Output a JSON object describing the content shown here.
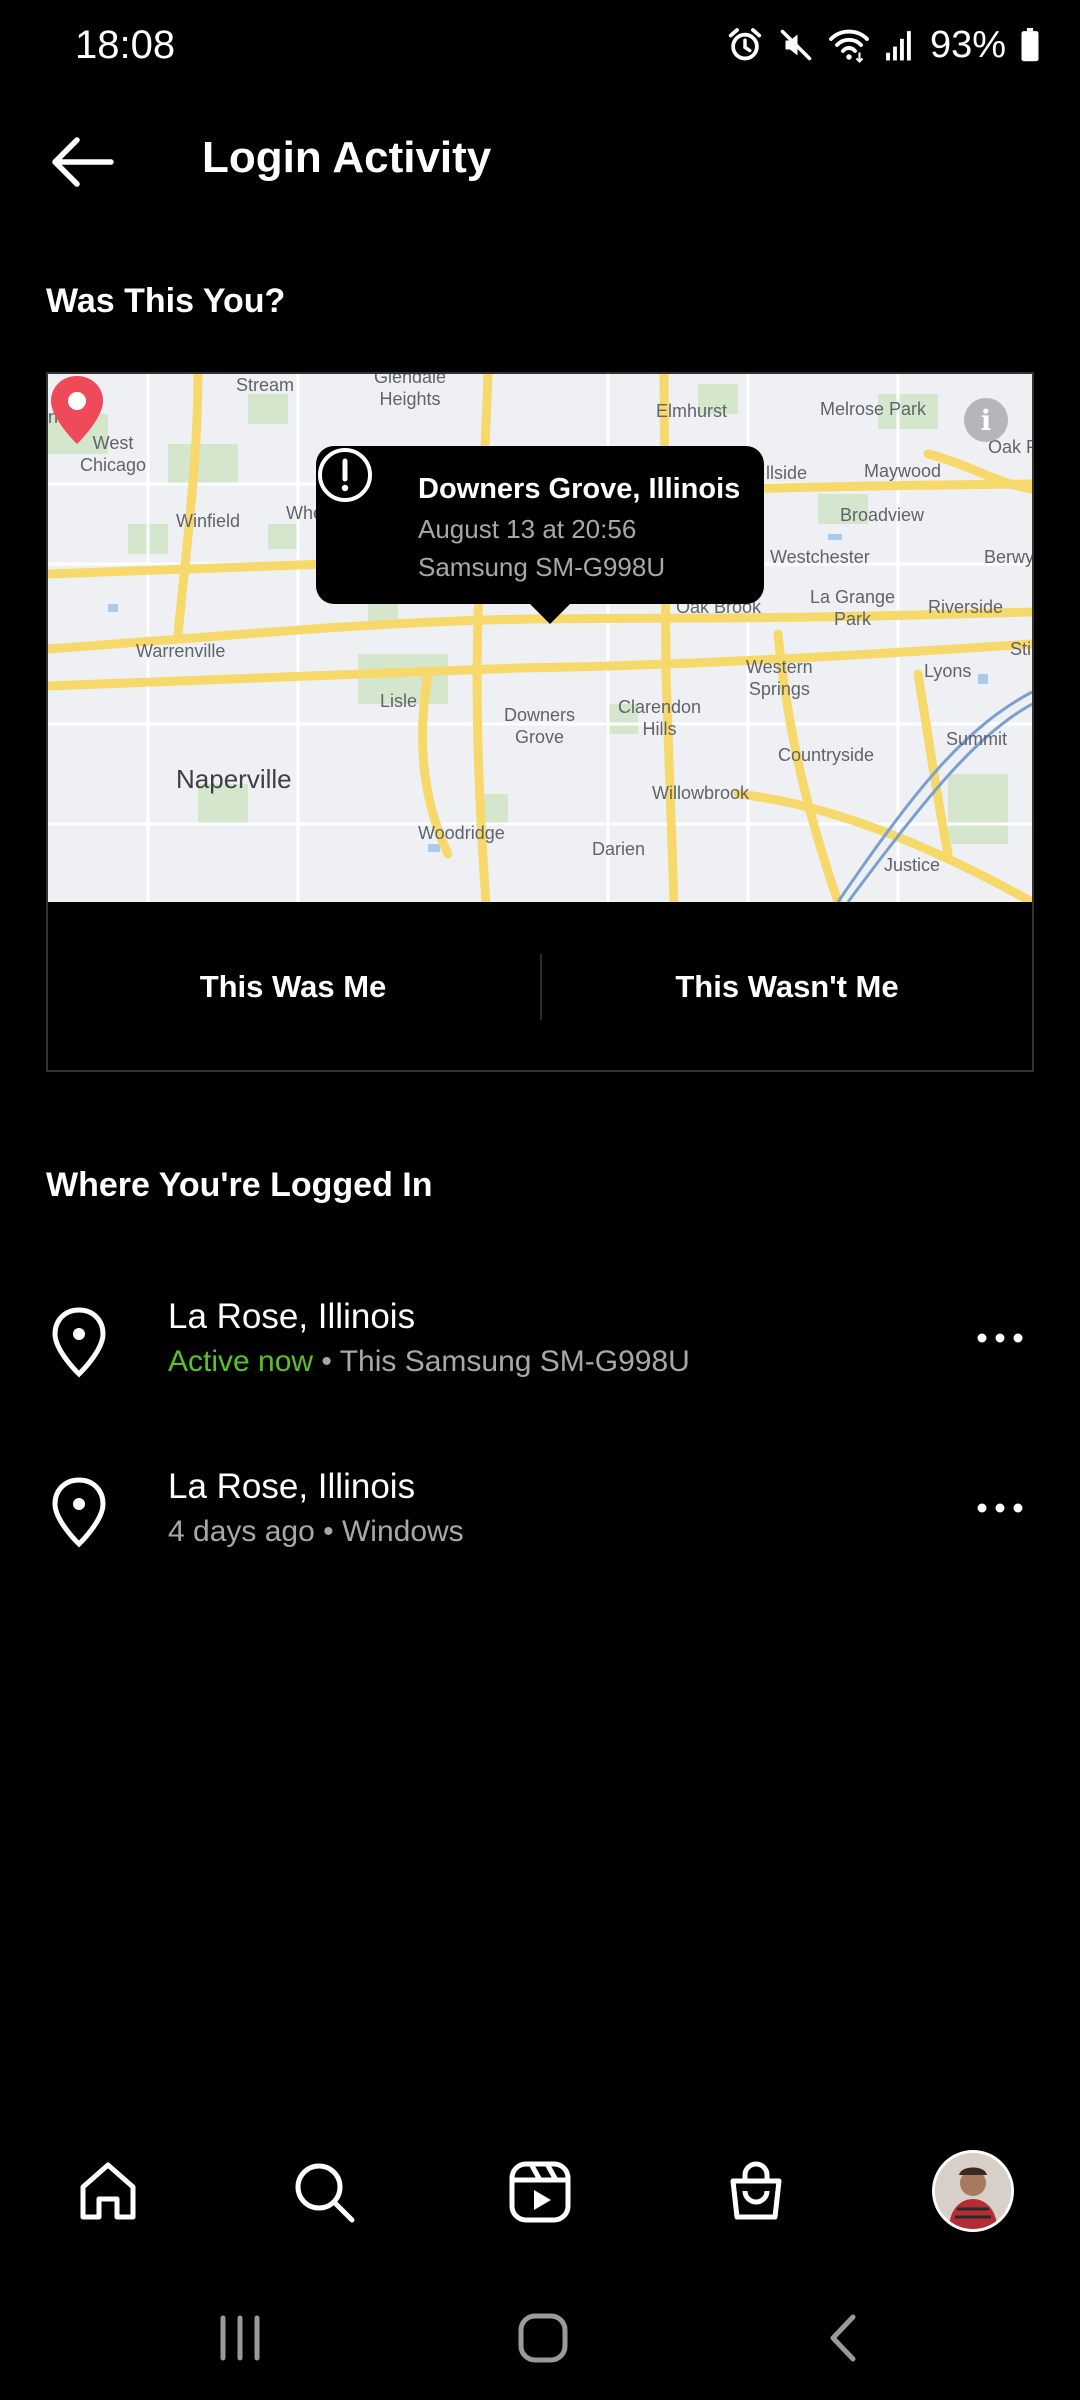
{
  "status_bar": {
    "time": "18:08",
    "battery": "93%"
  },
  "header": {
    "title": "Login Activity"
  },
  "suspicious_login": {
    "heading": "Was This You?",
    "location": "Downers Grove, Illinois",
    "date": "August 13 at 20:56",
    "device": "Samsung SM-G998U",
    "confirm_label": "This Was Me",
    "deny_label": "This Wasn't Me"
  },
  "map_labels": {
    "stream": "Stream",
    "glendale_heights": "Glendale\nHeights",
    "elmhurst": "Elmhurst",
    "melrose_park": "Melrose Park",
    "oak_park": "Oak P",
    "west_chicago": "West\nChicago",
    "winfield": "Winfield",
    "hillside": "llside",
    "maywood": "Maywood",
    "broadview": "Broadview",
    "westchester": "Westchester",
    "berwyn": "Berwy",
    "la_grange_park": "La Grange\nPark",
    "riverside": "Riverside",
    "oak_brook": "Oak Brook",
    "warrenville": "Warrenville",
    "lisle": "Lisle",
    "downers_grove": "Downers\nGrove",
    "clarendon_hills": "Clarendon\nHills",
    "western_springs": "Western\nSprings",
    "lyons": "Lyons",
    "summit": "Summit",
    "countryside": "Countryside",
    "naperville": "Naperville",
    "willowbrook": "Willowbrook",
    "woodridge": "Woodridge",
    "darien": "Darien",
    "justice": "Justice",
    "county_edge": "nty",
    "wheaton_edge": "Whe",
    "stickney_edge": "Sti"
  },
  "sessions_heading": "Where You're Logged In",
  "sessions": [
    {
      "location": "La Rose, Illinois",
      "status": "Active now",
      "separator": " • ",
      "device": "This Samsung SM-G998U"
    },
    {
      "location": "La Rose, Illinois",
      "status": "4 days ago",
      "separator": " • ",
      "device": "Windows"
    }
  ],
  "colors": {
    "active_status": "#58c322",
    "map_pin": "#ee4a5a",
    "map_background": "#eef0f3",
    "map_roads": "#f7d96b"
  }
}
